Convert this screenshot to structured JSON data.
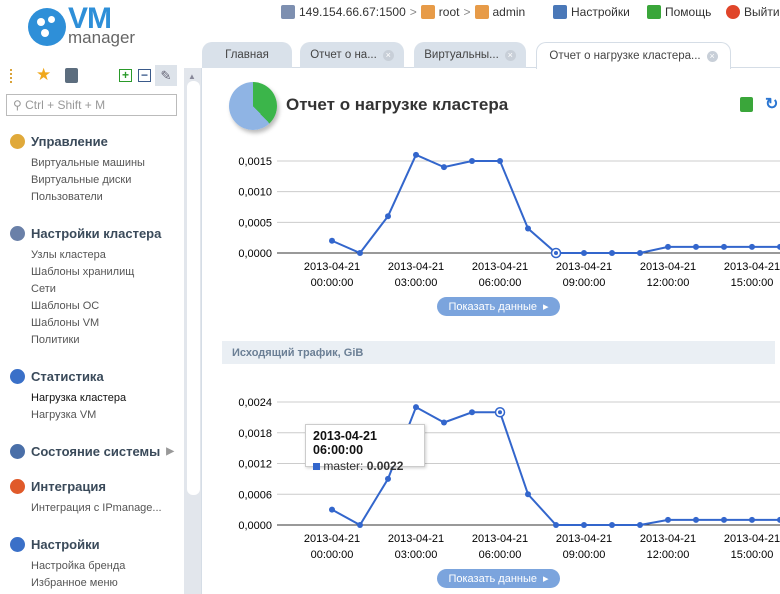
{
  "logo": {
    "brand": "VM",
    "sub": "manager"
  },
  "header": {
    "server": "149.154.66.67:1500",
    "user1": "root",
    "user2": "admin",
    "settings": "Настройки",
    "help": "Помощь",
    "logout": "Выйти",
    "sep": ">"
  },
  "tabs": [
    {
      "label": "Главная"
    },
    {
      "label": "Отчет о на..."
    },
    {
      "label": "Виртуальны..."
    },
    {
      "label": "Отчет о нагрузке кластера..."
    }
  ],
  "close_glyph": "×",
  "search": {
    "placeholder": "Ctrl + Shift + M"
  },
  "sidebar": {
    "groups": [
      {
        "label": "Управление",
        "items": [
          "Виртуальные машины",
          "Виртуальные диски",
          "Пользователи"
        ]
      },
      {
        "label": "Настройки кластера",
        "items": [
          "Узлы кластера",
          "Шаблоны хранилищ",
          "Сети",
          "Шаблоны ОС",
          "Шаблоны VM",
          "Политики"
        ]
      },
      {
        "label": "Статистика",
        "items": [
          "Нагрузка кластера",
          "Нагрузка VM"
        ]
      },
      {
        "label": "Состояние системы",
        "items": []
      },
      {
        "label": "Интеграция",
        "items": [
          "Интеграция с IPmanage..."
        ]
      },
      {
        "label": "Настройки",
        "items": [
          "Настройка бренда",
          "Избранное меню"
        ]
      }
    ]
  },
  "page": {
    "title": "Отчет о нагрузке кластера",
    "show_data": "Показать данные",
    "section2": "Исходящий трафик, GiB"
  },
  "tooltip": {
    "title": "2013-04-21 06:00:00",
    "series": "master:",
    "value": "0.0022"
  },
  "colors": {
    "line": "#3366cc",
    "accent": "#2e8fd8"
  },
  "chart_data": [
    {
      "type": "line",
      "title": "",
      "series": [
        {
          "name": "master",
          "values": [
            0.0002,
            0,
            0.0006,
            0.0016,
            0.0014,
            0.0015,
            0.0015,
            0.0004,
            0,
            0,
            0,
            0,
            0.0001,
            0.0001,
            0.0001,
            0.0001,
            0.0001
          ]
        }
      ],
      "yticks": [
        "0,0000",
        "0,0005",
        "0,0010",
        "0,0015"
      ],
      "ytick_values": [
        0,
        0.0005,
        0.001,
        0.0015
      ],
      "ylim": [
        0,
        0.0015
      ],
      "xticks": [
        [
          "2013-04-21",
          "00:00:00"
        ],
        [
          "2013-04-21",
          "03:00:00"
        ],
        [
          "2013-04-21",
          "06:00:00"
        ],
        [
          "2013-04-21",
          "09:00:00"
        ],
        [
          "2013-04-21",
          "12:00:00"
        ],
        [
          "2013-04-21",
          "15:00:00"
        ]
      ],
      "xtick_hours": [
        0,
        3,
        6,
        9,
        12,
        15
      ],
      "highlight": 8
    },
    {
      "type": "line",
      "title": "Исходящий трафик, GiB",
      "series": [
        {
          "name": "master",
          "values": [
            0.0003,
            0,
            0.0009,
            0.0023,
            0.002,
            0.0022,
            0.0022,
            0.0006,
            0,
            0,
            0,
            0,
            0.0001,
            0.0001,
            0.0001,
            0.0001,
            0.0001
          ]
        }
      ],
      "yticks": [
        "0,0000",
        "0,0006",
        "0,0012",
        "0,0018",
        "0,0024"
      ],
      "ytick_values": [
        0,
        0.0006,
        0.0012,
        0.0018,
        0.0024
      ],
      "ylim": [
        0,
        0.0024
      ],
      "xticks": [
        [
          "2013-04-21",
          "00:00:00"
        ],
        [
          "2013-04-21",
          "03:00:00"
        ],
        [
          "2013-04-21",
          "06:00:00"
        ],
        [
          "2013-04-21",
          "09:00:00"
        ],
        [
          "2013-04-21",
          "12:00:00"
        ],
        [
          "2013-04-21",
          "15:00:00"
        ]
      ],
      "xtick_hours": [
        0,
        3,
        6,
        9,
        12,
        15
      ],
      "highlight": 6
    }
  ]
}
